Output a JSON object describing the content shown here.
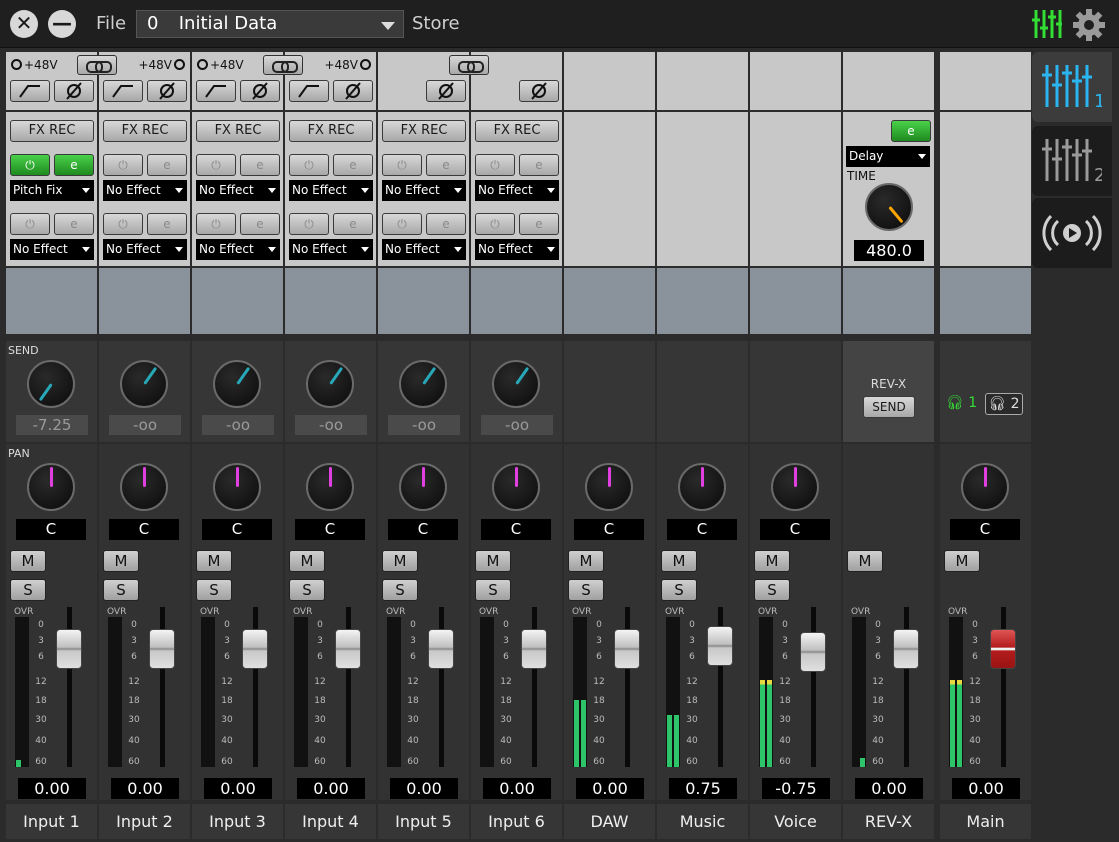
{
  "topbar": {
    "file_label": "File",
    "scene_number": "0",
    "scene_name": "Initial Data",
    "store_label": "Store",
    "close_icon": "close-icon",
    "minimize_icon": "minimize-icon",
    "mixer_icon": "mixer-icon",
    "settings_icon": "gear-icon"
  },
  "colors": {
    "accent_green": "#33dd33",
    "accent_blue": "#2ab4f0",
    "send_knob": "#27a8b8",
    "pan_knob": "#e040e0",
    "time_knob": "#ffa500"
  },
  "labels": {
    "phantom": "+48V",
    "fx_rec": "FX REC",
    "send_section": "SEND",
    "pan_section": "PAN",
    "rev_x": "REV-X",
    "send_button": "SEND",
    "mute": "M",
    "solo": "S",
    "ovr": "OVR",
    "time": "TIME",
    "hp1": "1",
    "hp2": "2"
  },
  "meter_scale": [
    "0",
    "3",
    "6",
    "12",
    "18",
    "30",
    "40",
    "60"
  ],
  "fx_types": {
    "ch56_effect": "Delay",
    "time_value": "480.0"
  },
  "side_tabs": [
    {
      "name": "mixer-1",
      "badge": "1"
    },
    {
      "name": "mixer-2",
      "badge": "2"
    },
    {
      "name": "stream",
      "badge": ""
    }
  ],
  "channels": [
    {
      "name": "Input 1",
      "fx1": "Pitch Fix",
      "fx2": "No Effect",
      "send": "-7.25",
      "pan": "C",
      "fader": "0.00",
      "level_l": 0.05,
      "level_r": 0.0
    },
    {
      "name": "Input 2",
      "fx1": "No Effect",
      "fx2": "No Effect",
      "send": "-oo",
      "pan": "C",
      "fader": "0.00",
      "level_l": 0.0,
      "level_r": 0.0
    },
    {
      "name": "Input 3",
      "fx1": "No Effect",
      "fx2": "No Effect",
      "send": "-oo",
      "pan": "C",
      "fader": "0.00",
      "level_l": 0.0,
      "level_r": 0.0
    },
    {
      "name": "Input 4",
      "fx1": "No Effect",
      "fx2": "No Effect",
      "send": "-oo",
      "pan": "C",
      "fader": "0.00",
      "level_l": 0.0,
      "level_r": 0.0
    },
    {
      "name": "Input 5",
      "fx1": "No Effect",
      "fx2": "No Effect",
      "send": "-oo",
      "pan": "C",
      "fader": "0.00",
      "level_l": 0.0,
      "level_r": 0.0
    },
    {
      "name": "Input 6",
      "fx1": "No Effect",
      "fx2": "No Effect",
      "send": "-oo",
      "pan": "C",
      "fader": "0.00",
      "level_l": 0.0,
      "level_r": 0.0
    },
    {
      "name": "DAW",
      "pan": "C",
      "fader": "0.00",
      "level_l": 0.45,
      "level_r": 0.45
    },
    {
      "name": "Music",
      "pan": "C",
      "fader": "0.75",
      "level_l": 0.35,
      "level_r": 0.35
    },
    {
      "name": "Voice",
      "pan": "C",
      "fader": "-0.75",
      "level_l": 0.58,
      "level_r": 0.58
    },
    {
      "name": "REV-X",
      "fader": "0.00",
      "level_l": 0.0,
      "level_r": 0.06
    },
    {
      "name": "Main",
      "pan": "C",
      "fader": "0.00",
      "level_l": 0.58,
      "level_r": 0.58
    }
  ]
}
